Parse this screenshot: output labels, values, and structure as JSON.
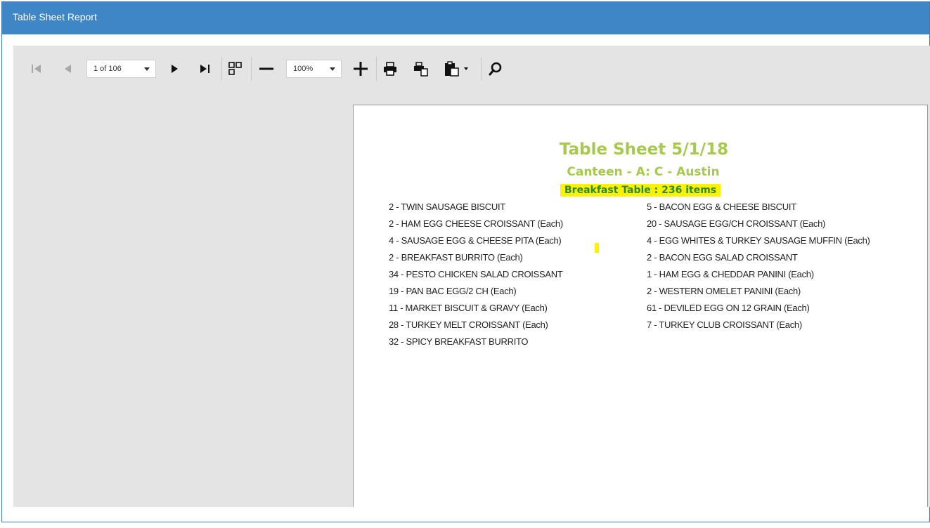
{
  "window": {
    "title": "Table Sheet Report"
  },
  "toolbar": {
    "page_select": "1 of 106",
    "zoom_select": "100%",
    "icons": [
      "first-page-icon",
      "prev-page-icon",
      "next-page-icon",
      "last-page-icon",
      "multi-page-icon",
      "zoom-out-icon",
      "zoom-in-icon",
      "print-icon",
      "print-page-icon",
      "export-icon",
      "search-icon"
    ]
  },
  "report": {
    "title": "Table Sheet  5/1/18",
    "subtitle": "Canteen - A: C - Austin",
    "highlight": "Breakfast Table : 236 items",
    "left_items": [
      "2 - TWIN SAUSAGE BISCUIT",
      "2 - HAM EGG CHEESE CROISSANT (Each)",
      "4 - SAUSAGE EGG & CHEESE PITA (Each)",
      "2 - BREAKFAST BURRITO (Each)",
      "34 - PESTO CHICKEN SALAD CROISSANT",
      "19 - PAN BAC EGG/2 CH (Each)",
      "11 - MARKET BISCUIT & GRAVY (Each)",
      "28 - TURKEY MELT CROISSANT (Each)",
      "32 - SPICY BREAKFAST BURRITO"
    ],
    "right_items": [
      "5 - BACON EGG & CHEESE BISCUIT",
      "20 - SAUSAGE EGG/CH CROISSANT (Each)",
      "4 - EGG WHITES & TURKEY SAUSAGE MUFFIN (Each)",
      "2 - BACON  EGG SALAD CROISSANT",
      "1 - HAM EGG & CHEDDAR PANINI (Each)",
      "2 - WESTERN OMELET PANINI (Each)",
      "61 - DEVILED EGG ON 12 GRAIN (Each)",
      "7 - TURKEY CLUB CROISSANT (Each)"
    ]
  },
  "colors": {
    "titlebar": "#3f86c6",
    "report_title": "#a6c94e",
    "highlight_bg": "#fff200",
    "highlight_text": "#2d8a2d"
  }
}
